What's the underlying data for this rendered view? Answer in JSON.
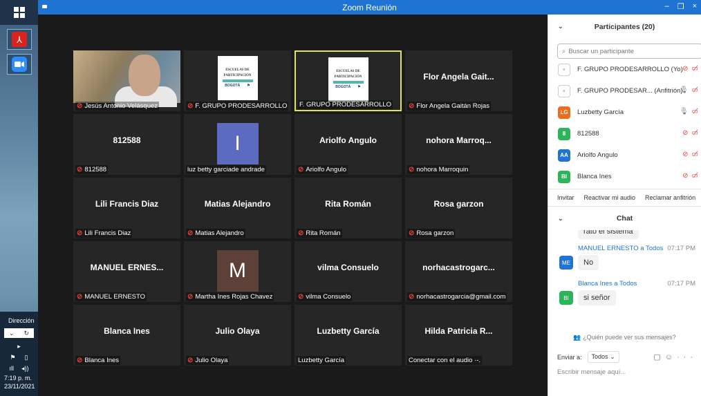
{
  "window": {
    "title": "Zoom Reunión",
    "minimize": "–",
    "restore": "❐",
    "close": "×"
  },
  "taskbar": {
    "tray_label": "Dirección",
    "time": "7:19 p. m.",
    "date": "23/11/2021"
  },
  "tiles": [
    {
      "name": "",
      "label": "Jesús Antonio Velásquez",
      "muted": true,
      "kind": "video"
    },
    {
      "name": "",
      "label": "F. GRUPO PRODESARROLLO",
      "muted": true,
      "kind": "logo"
    },
    {
      "name": "",
      "label": "F. GRUPO PRODESARROLLO",
      "muted": false,
      "kind": "logo",
      "active": true
    },
    {
      "name": "Flor Angela Gait...",
      "label": "Flor Angela Gaitán Rojas",
      "muted": true,
      "kind": "text"
    },
    {
      "name": "812588",
      "label": "812588",
      "muted": true,
      "kind": "text"
    },
    {
      "name": "I",
      "label": "luz betty garciade andrade",
      "muted": false,
      "kind": "avatar",
      "color": "#5c6bc0"
    },
    {
      "name": "Ariolfo Angulo",
      "label": "Ariolfo Angulo",
      "muted": true,
      "kind": "text"
    },
    {
      "name": "nohora  Marroq...",
      "label": "nohora Marroquin",
      "muted": true,
      "kind": "text"
    },
    {
      "name": "Lili Francis Diaz",
      "label": "Lili Francis Diaz",
      "muted": true,
      "kind": "text"
    },
    {
      "name": "Matias Alejandro",
      "label": "Matias Alejandro",
      "muted": true,
      "kind": "text"
    },
    {
      "name": "Rita Román",
      "label": "Rita Román",
      "muted": true,
      "kind": "text"
    },
    {
      "name": "Rosa garzon",
      "label": "Rosa garzon",
      "muted": true,
      "kind": "text"
    },
    {
      "name": "MANUEL  ERNES...",
      "label": "MANUEL ERNESTO",
      "muted": true,
      "kind": "text"
    },
    {
      "name": "M",
      "label": "Martha Ines Rojas Chavez",
      "muted": true,
      "kind": "avatar",
      "color": "#5d4037"
    },
    {
      "name": "vilma Consuelo",
      "label": "vilma Consuelo",
      "muted": true,
      "kind": "text"
    },
    {
      "name": "norhacastrogarc...",
      "label": "norhacastrogarcia@gmail.com",
      "muted": true,
      "kind": "text"
    },
    {
      "name": "Blanca Ines",
      "label": "Blanca Ines",
      "muted": true,
      "kind": "text"
    },
    {
      "name": "Julio Olaya",
      "label": "Julio Olaya",
      "muted": true,
      "kind": "text"
    },
    {
      "name": "Luzbetty García",
      "label": "Luzbetty García",
      "muted": false,
      "kind": "text"
    },
    {
      "name": "Hilda Patricia R...",
      "label": "Conectar con el audio ·-.",
      "muted": false,
      "kind": "text"
    }
  ],
  "logo_text": {
    "line1": "ESCUELAS DE",
    "line2": "PARTICIPACIÓN",
    "left": "BOGOTÁ",
    "right": "⚑"
  },
  "participants": {
    "title": "Participantes (20)",
    "search_placeholder": "Buscar un participante",
    "items": [
      {
        "name": "F. GRUPO PRODESARROLLO (Yo)",
        "initials": "≡",
        "color": "#ffffff",
        "mic": "muted"
      },
      {
        "name": "F. GRUPO PRODESAR... (Anfitrión)",
        "initials": "≡",
        "color": "#ffffff",
        "mic": "on"
      },
      {
        "name": "Luzbetty García",
        "initials": "LG",
        "color": "#f26b1d",
        "mic": "on"
      },
      {
        "name": "812588",
        "initials": "8",
        "color": "#2db45a",
        "mic": "muted"
      },
      {
        "name": "Ariolfo Angulo",
        "initials": "AA",
        "color": "#1e73d3",
        "mic": "muted"
      },
      {
        "name": "Blanca Ines",
        "initials": "BI",
        "color": "#2db45a",
        "mic": "muted"
      }
    ],
    "buttons": [
      "Invitar",
      "Reactivar mi audio",
      "Reclamar anfitrión"
    ]
  },
  "chat": {
    "title": "Chat",
    "partial_message": "rato el sistema",
    "messages": [
      {
        "sender": "MANUEL ERNESTO a Todos",
        "time": "07:17 PM",
        "text": "No",
        "initials": "ME",
        "color": "#1e73d3"
      },
      {
        "sender": "Blanca Ines a Todos",
        "time": "07:17 PM",
        "text": "si señor",
        "initials": "BI",
        "color": "#2db45a"
      }
    ],
    "who_can_see": "¿Quién puede ver sus mensajes?",
    "send_to_label": "Enviar a:",
    "send_to_value": "Todos",
    "compose_placeholder": "Escribir mensaje aquí..."
  }
}
